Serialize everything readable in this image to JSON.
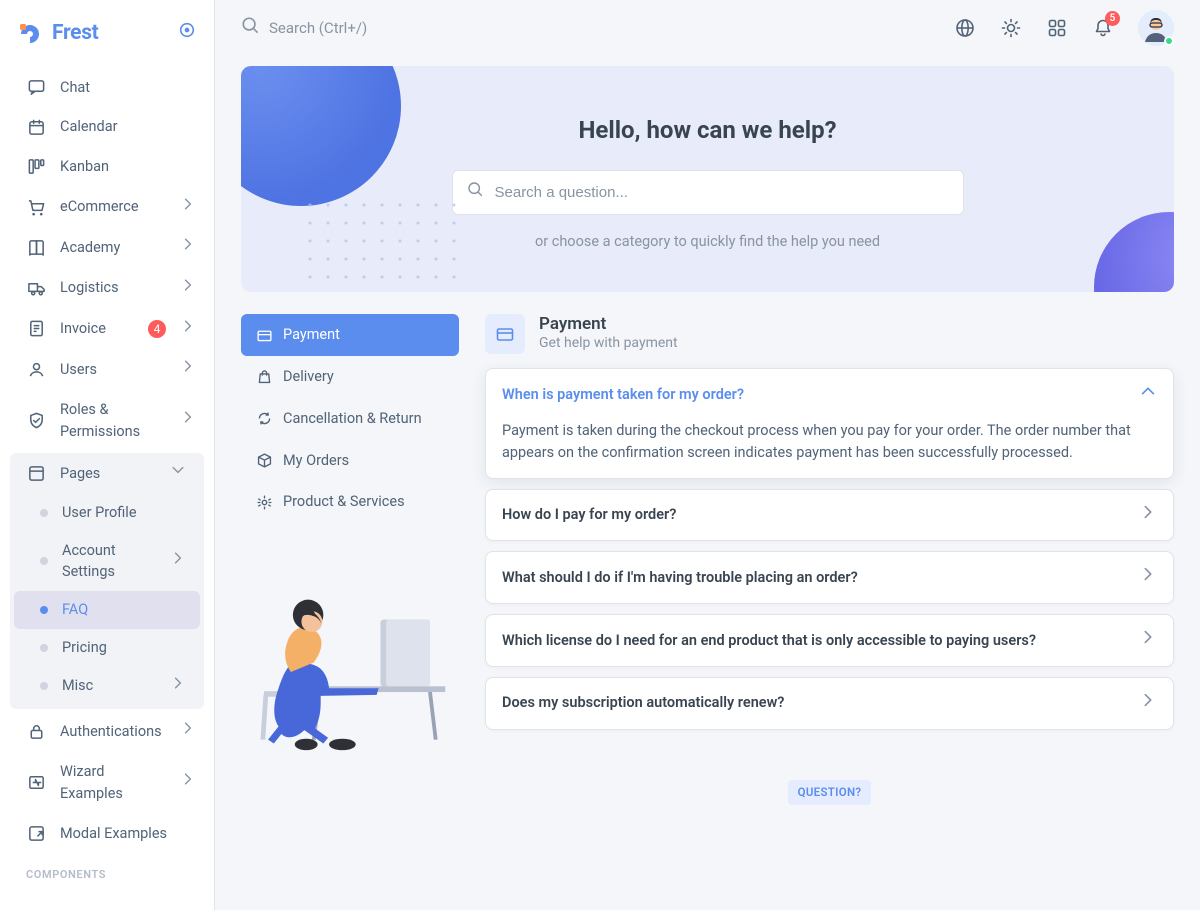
{
  "brand": {
    "name": "Frest"
  },
  "topbar": {
    "search_placeholder": "Search (Ctrl+/)",
    "notification_count": "5"
  },
  "sidebar": {
    "items": [
      {
        "icon": "chat-icon",
        "label": "Chat"
      },
      {
        "icon": "calendar-icon",
        "label": "Calendar"
      },
      {
        "icon": "kanban-icon",
        "label": "Kanban"
      },
      {
        "icon": "cart-icon",
        "label": "eCommerce",
        "children": true
      },
      {
        "icon": "book-icon",
        "label": "Academy",
        "children": true
      },
      {
        "icon": "truck-icon",
        "label": "Logistics",
        "children": true
      },
      {
        "icon": "invoice-icon",
        "label": "Invoice",
        "badge": "4",
        "children": true
      },
      {
        "icon": "users-icon",
        "label": "Users",
        "children": true
      },
      {
        "icon": "shield-icon",
        "label": "Roles & Permissions",
        "children": true
      }
    ],
    "pages_label": "Pages",
    "pages_children": [
      {
        "label": "User Profile"
      },
      {
        "label": "Account Settings",
        "children": true
      },
      {
        "label": "FAQ",
        "active": true
      },
      {
        "label": "Pricing"
      },
      {
        "label": "Misc",
        "children": true
      }
    ],
    "tail": [
      {
        "icon": "lock-icon",
        "label": "Authentications",
        "children": true
      },
      {
        "icon": "wizard-icon",
        "label": "Wizard Examples",
        "children": true
      },
      {
        "icon": "modal-icon",
        "label": "Modal Examples"
      }
    ],
    "section_label": "COMPONENTS"
  },
  "hero": {
    "title": "Hello, how can we help?",
    "search_placeholder": "Search a question...",
    "sub": "or choose a category to quickly find the help you need"
  },
  "cats": [
    {
      "icon": "card-icon",
      "label": "Payment",
      "active": true
    },
    {
      "icon": "bag-icon",
      "label": "Delivery"
    },
    {
      "icon": "refresh-icon",
      "label": "Cancellation & Return"
    },
    {
      "icon": "box-icon",
      "label": "My Orders"
    },
    {
      "icon": "gear-icon",
      "label": "Product & Services"
    }
  ],
  "faq": {
    "heading": "Payment",
    "sub": "Get help with payment",
    "items": [
      {
        "q": "When is payment taken for my order?",
        "a": "Payment is taken during the checkout process when you pay for your order. The order number that appears on the confirmation screen indicates payment has been successfully processed.",
        "open": true
      },
      {
        "q": "How do I pay for my order?"
      },
      {
        "q": "What should I do if I'm having trouble placing an order?"
      },
      {
        "q": "Which license do I need for an end product that is only accessible to paying users?"
      },
      {
        "q": "Does my subscription automatically renew?"
      }
    ],
    "badge": "QUESTION?"
  }
}
